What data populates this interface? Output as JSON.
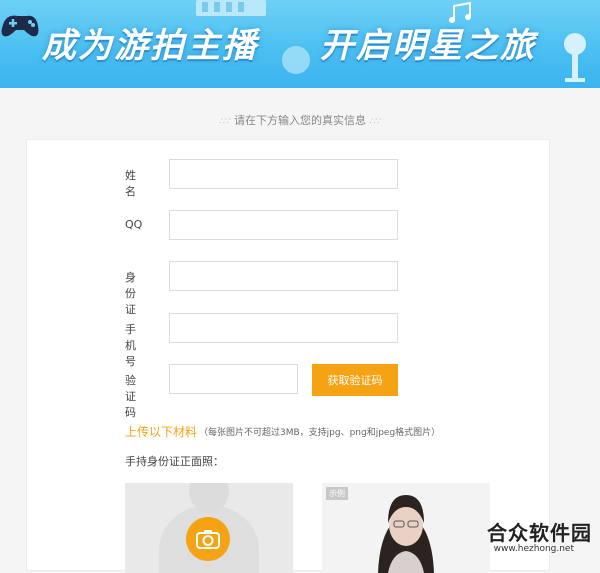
{
  "banner": {
    "title_left": "成为游拍主播",
    "title_right": "开启明星之旅"
  },
  "subtitle": "请在下方输入您的真实信息",
  "form": {
    "fields": [
      {
        "label": "姓名",
        "value": "",
        "placeholder": ""
      },
      {
        "label": "QQ",
        "value": "",
        "placeholder": ""
      },
      {
        "label": "身份证",
        "value": "",
        "placeholder": ""
      },
      {
        "label": "手机号",
        "value": "",
        "placeholder": ""
      },
      {
        "label": "验证码",
        "value": "",
        "placeholder": ""
      }
    ],
    "code_button": "获取验证码"
  },
  "upload": {
    "title": "上传以下材料",
    "note": "（每张图片不可超过3MB，支持jpg、png和jpeg格式图片）",
    "hold_id_label": "手持身份证正面照：",
    "sample_tag": "示例"
  },
  "watermark": {
    "brand": "合众软件园",
    "url": "www.hezhong.net"
  },
  "colors": {
    "accent": "#f6a313",
    "banner": "#4cc0f2"
  },
  "icons": [
    "gamepad-icon",
    "music-note-icon",
    "microphone-icon",
    "camera-icon"
  ]
}
